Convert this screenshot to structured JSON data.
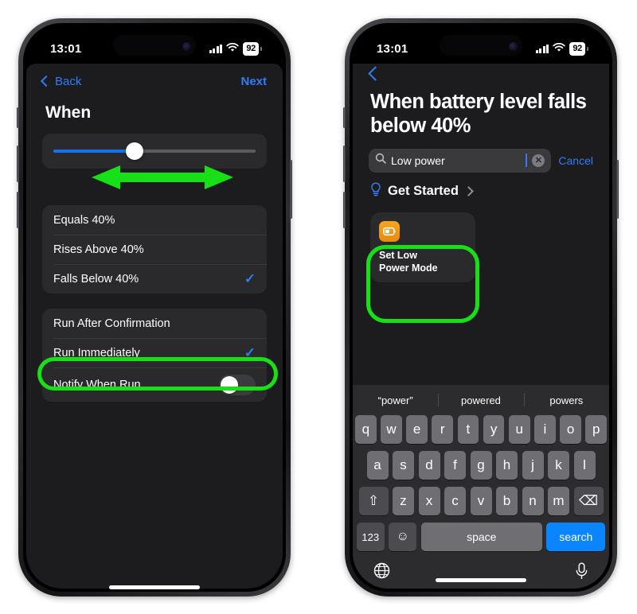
{
  "status_bar": {
    "time": "13:01",
    "battery_percent": "92",
    "signal_icon": "cellular-signal-icon",
    "wifi_icon": "wifi-icon"
  },
  "left_phone": {
    "nav": {
      "back_label": "Back",
      "next_label": "Next"
    },
    "section_title": "When",
    "slider": {
      "value_percent": 40,
      "fill_color": "#1372ec"
    },
    "condition_options": [
      {
        "label": "Equals 40%",
        "selected": false
      },
      {
        "label": "Rises Above 40%",
        "selected": false
      },
      {
        "label": "Falls Below 40%",
        "selected": true
      }
    ],
    "run_options": [
      {
        "label": "Run After Confirmation",
        "selected": false,
        "type": "option"
      },
      {
        "label": "Run Immediately",
        "selected": true,
        "type": "option"
      },
      {
        "label": "Notify When Run",
        "toggle_on": false,
        "type": "toggle"
      }
    ],
    "annotations": {
      "arrow_color": "#17e017",
      "highlight_color": "#17e017",
      "highlighted_row": "Run Immediately"
    }
  },
  "right_phone": {
    "title": "When battery level falls below 40%",
    "search": {
      "value": "Low power",
      "icon": "search-icon",
      "clear_label": "✕",
      "cancel_label": "Cancel"
    },
    "get_started": {
      "label": "Get Started",
      "icon": "lightbulb-icon"
    },
    "result_card": {
      "title": "Set Low\nPower Mode",
      "title_line1": "Set Low",
      "title_line2": "Power Mode",
      "icon": "battery-low-power-icon",
      "icon_color": "#f09215",
      "highlighted": true
    },
    "keyboard": {
      "predictions": [
        "“power”",
        "powered",
        "powers"
      ],
      "row1": [
        "q",
        "w",
        "e",
        "r",
        "t",
        "y",
        "u",
        "i",
        "o",
        "p"
      ],
      "row2": [
        "a",
        "s",
        "d",
        "f",
        "g",
        "h",
        "j",
        "k",
        "l"
      ],
      "row3": [
        "z",
        "x",
        "c",
        "v",
        "b",
        "n",
        "m"
      ],
      "shift_label": "⇧",
      "backspace_label": "⌫",
      "numbers_label": "123",
      "emoji_label": "☺",
      "space_label": "space",
      "return_label": "search",
      "globe_icon": "globe-icon",
      "mic_icon": "microphone-icon"
    }
  }
}
